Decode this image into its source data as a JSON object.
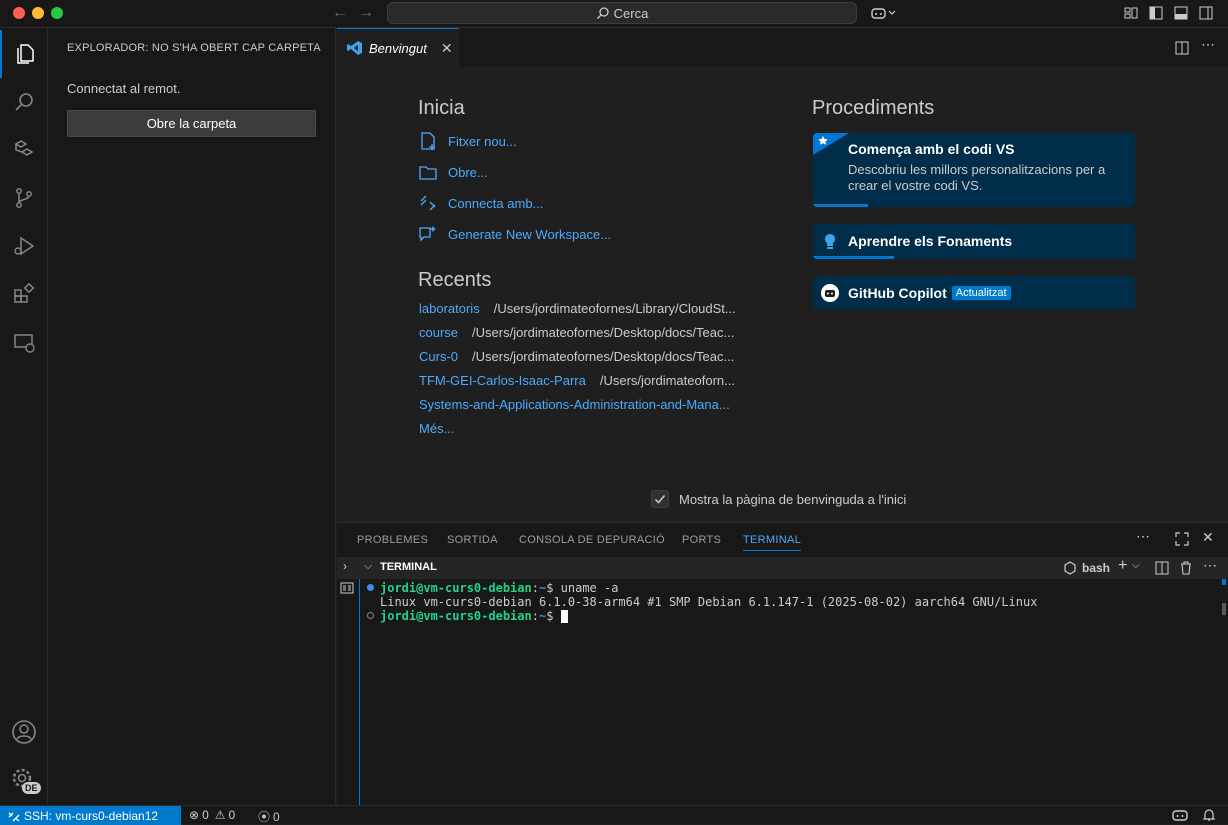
{
  "titlebar": {
    "search_label": "Cerca"
  },
  "sidebar": {
    "title": "EXPLORADOR: NO S'HA OBERT CAP CARPETA",
    "message": "Connectat al remot.",
    "open_folder_button": "Obre la carpeta"
  },
  "editor_tabs": [
    {
      "label": "Benvingut"
    }
  ],
  "welcome": {
    "start": {
      "heading": "Inicia",
      "items": [
        {
          "label": "Fitxer nou..."
        },
        {
          "label": "Obre..."
        },
        {
          "label": "Connecta amb..."
        },
        {
          "label": "Generate New Workspace..."
        }
      ]
    },
    "recent": {
      "heading": "Recents",
      "items": [
        {
          "name": "laboratoris",
          "path": "/Users/jordimateofornes/Library/CloudSt..."
        },
        {
          "name": "course",
          "path": "/Users/jordimateofornes/Desktop/docs/Teac..."
        },
        {
          "name": "Curs-0",
          "path": "/Users/jordimateofornes/Desktop/docs/Teac..."
        },
        {
          "name": "TFM-GEI-Carlos-Isaac-Parra",
          "path": "/Users/jordimateoforn..."
        },
        {
          "name": "Systems-and-Applications-Administration-and-Mana...",
          "path": ""
        }
      ],
      "more": "Més..."
    },
    "walkthroughs": {
      "heading": "Procediments",
      "cards": [
        {
          "title": "Comença amb el codi VS",
          "description": "Descobriu les millors personalitzacions per a crear el vostre codi VS.",
          "progress": 0.17
        },
        {
          "title": "Aprendre els Fonaments",
          "progress": 0.25
        },
        {
          "title": "GitHub Copilot",
          "badge": "Actualitzat"
        }
      ]
    },
    "show_on_startup": "Mostra la pàgina de benvinguda a l'inici",
    "show_on_startup_checked": true
  },
  "panel": {
    "tabs": [
      {
        "label": "PROBLEMES"
      },
      {
        "label": "SORTIDA"
      },
      {
        "label": "CONSOLA DE DEPURACIÓ"
      },
      {
        "label": "PORTS"
      },
      {
        "label": "TERMINAL"
      }
    ],
    "active_tab": "TERMINAL",
    "terminal": {
      "header": "TERMINAL",
      "shell": "bash",
      "lines": [
        {
          "user": "jordi@vm-curs0-debian",
          "path": "~",
          "command": "uname -a"
        },
        {
          "output": "Linux vm-curs0-debian 6.1.0-38-arm64 #1 SMP Debian 6.1.147-1 (2025-08-02) aarch64 GNU/Linux"
        },
        {
          "user": "jordi@vm-curs0-debian",
          "path": "~",
          "command": ""
        }
      ]
    }
  },
  "statusbar": {
    "remote": "SSH: vm-curs0-debian12",
    "errors": "0",
    "warnings": "0",
    "ports": "0"
  },
  "account_badge": "DE",
  "colors": {
    "accent": "#0078d4",
    "link": "#4daafc",
    "remote_bg": "#007acc",
    "card_bg": "#002d4a"
  }
}
